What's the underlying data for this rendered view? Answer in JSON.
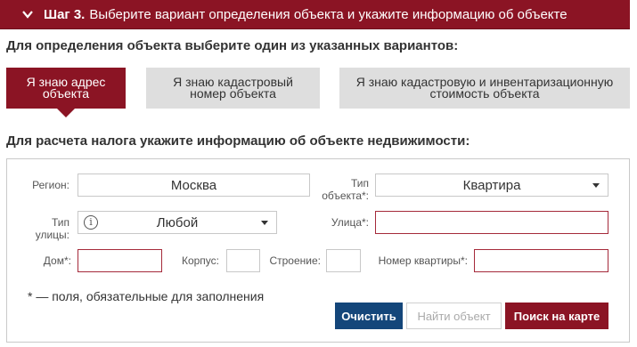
{
  "step": {
    "label": "Шаг 3.",
    "text": "Выберите вариант определения объекта и укажите информацию об объекте"
  },
  "variants_heading": "Для определения объекта выберите один из указанных вариантов:",
  "tabs": [
    {
      "label_line1": "Я знаю адрес",
      "label_line2": "объекта",
      "active": true
    },
    {
      "label_line1": "Я знаю кадастровый",
      "label_line2": "номер объекта",
      "active": false
    },
    {
      "label_line1": "Я знаю кадастровую и инвентаризационную",
      "label_line2": "стоимость объекта",
      "active": false
    }
  ],
  "info_heading": "Для расчета налога укажите информацию об объекте недвижимости:",
  "form": {
    "region_label": "Регион:",
    "region_value": "Москва",
    "object_type_label_1": "Тип",
    "object_type_label_2": "объекта*:",
    "object_type_value": "Квартира",
    "street_type_label_1": "Тип",
    "street_type_label_2": "улицы:",
    "street_type_value": "Любой",
    "info_symbol": "i",
    "street_label": "Улица*:",
    "street_value": "",
    "house_label": "Дом*:",
    "house_value": "",
    "building_label": "Корпус:",
    "building_value": "",
    "structure_label": "Строение:",
    "structure_value": "",
    "apartment_label": "Номер квартиры*:",
    "apartment_value": ""
  },
  "required_note": "* — поля, обязательные для заполнения",
  "buttons": {
    "clear": "Очистить",
    "find": "Найти объект",
    "map": "Поиск на карте"
  },
  "colors": {
    "brand_red": "#8b1424",
    "button_blue": "#14467a",
    "tab_inactive": "#dedede",
    "required_border": "#a52a3a"
  }
}
